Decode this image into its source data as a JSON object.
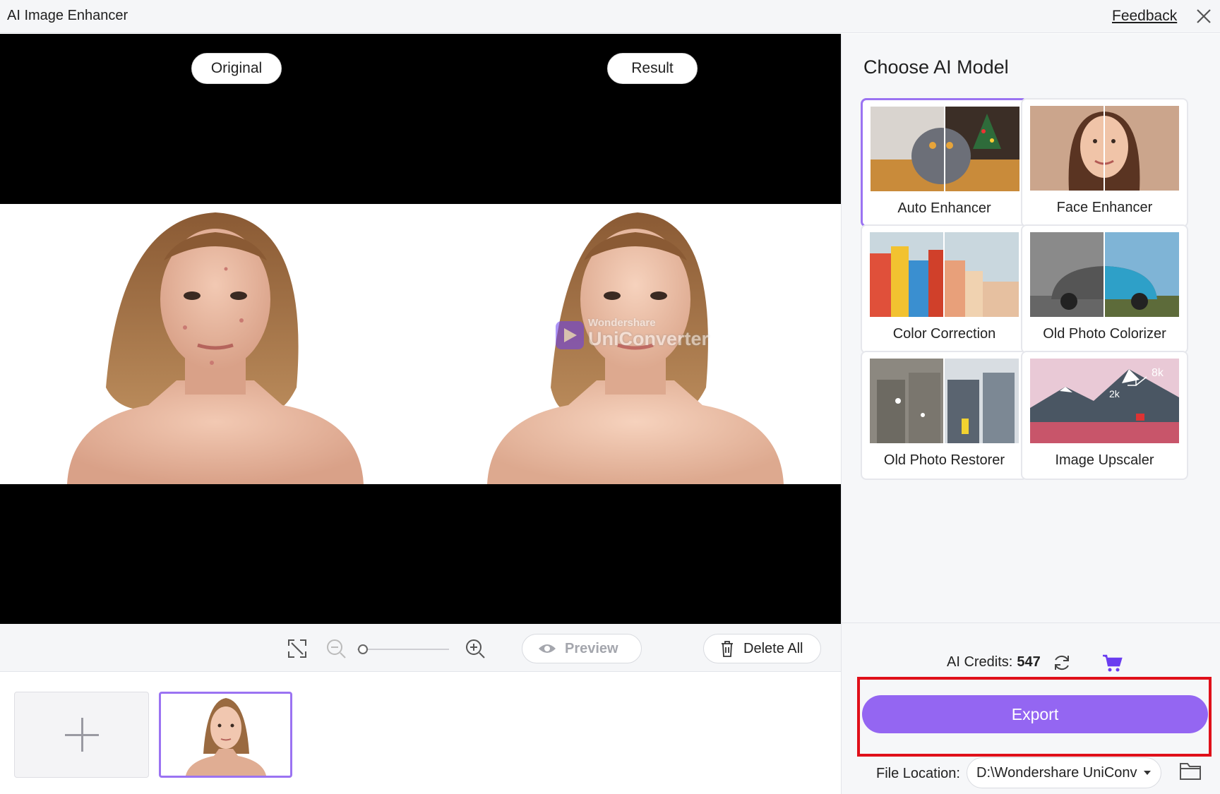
{
  "window": {
    "title": "AI Image Enhancer",
    "feedback_label": "Feedback",
    "close_icon": "close-icon"
  },
  "compare": {
    "original_label": "Original",
    "result_label": "Result",
    "watermark_brand": "Wondershare",
    "watermark_product": "UniConverter"
  },
  "toolbar": {
    "fit_icon": "fit-screen-icon",
    "zoom_out_icon": "zoom-out-icon",
    "zoom_in_icon": "zoom-in-icon",
    "zoom_level": 0,
    "preview_label": "Preview",
    "delete_all_label": "Delete All"
  },
  "panel": {
    "title": "Choose AI Model",
    "models": [
      {
        "label": "Auto Enhancer",
        "selected": true
      },
      {
        "label": "Face Enhancer",
        "selected": false
      },
      {
        "label": "Color Correction",
        "selected": false
      },
      {
        "label": "Old Photo Colorizer",
        "selected": false
      },
      {
        "label": "Old Photo Restorer",
        "selected": false
      },
      {
        "label": "Image Upscaler",
        "selected": false
      }
    ],
    "upscaler_tags": [
      "8k",
      "2k"
    ],
    "credits_label": "AI Credits:",
    "credits_value": "547",
    "export_label": "Export",
    "file_location_label": "File Location:",
    "file_location_value": "D:\\Wondershare UniConv"
  },
  "colors": {
    "accent": "#9466f2",
    "selected_border": "#9b73f2",
    "highlight": "#e0101a"
  }
}
